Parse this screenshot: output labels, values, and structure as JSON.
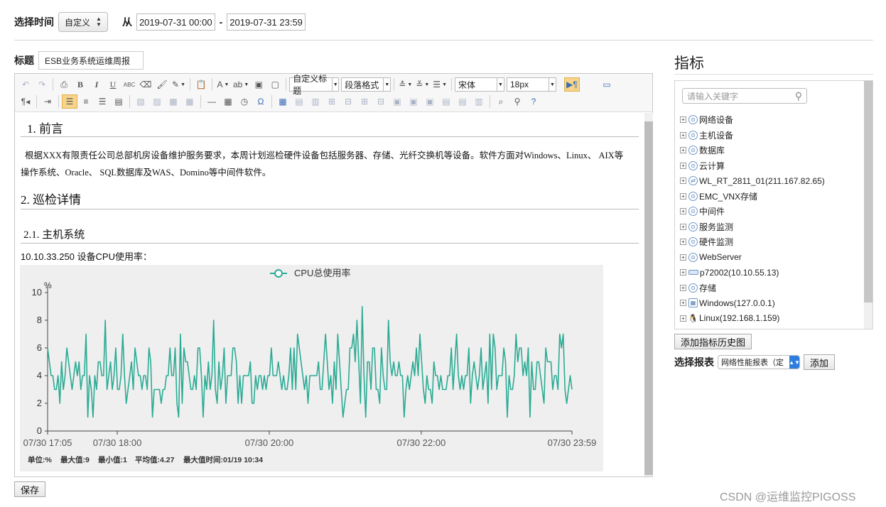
{
  "filter": {
    "time_label": "选择时间",
    "mode_value": "自定义",
    "from_label": "从",
    "start": "2019-07-31 00:00",
    "separator": "-",
    "end": "2019-07-31 23:59"
  },
  "title_row": {
    "label": "标题",
    "value": "ESB业务系统运维周报"
  },
  "toolbar": {
    "row1": [
      {
        "name": "undo-icon",
        "glyph": "↶",
        "dim": true
      },
      {
        "name": "redo-icon",
        "glyph": "↷",
        "dim": true
      },
      {
        "sep": true
      },
      {
        "name": "print-icon",
        "glyph": "⎙"
      },
      {
        "name": "bold-icon",
        "glyph": "B",
        "bold": true
      },
      {
        "name": "italic-icon",
        "glyph": "I",
        "italic": true
      },
      {
        "name": "underline-icon",
        "glyph": "U",
        "underline": true
      },
      {
        "name": "strikethrough-icon",
        "glyph": "ABC",
        "small": true
      },
      {
        "name": "eraser-icon",
        "glyph": "⌫"
      },
      {
        "name": "format-brush-icon",
        "glyph": "🖌"
      },
      {
        "name": "magic-format-icon",
        "glyph": "✎",
        "dd": true
      },
      {
        "sep": true
      },
      {
        "name": "paste-text-icon",
        "glyph": "📋"
      },
      {
        "sep": true
      },
      {
        "name": "font-color-icon",
        "glyph": "A",
        "dd": true
      },
      {
        "name": "background-color-icon",
        "glyph": "ab",
        "dd": true
      },
      {
        "name": "text-box-icon",
        "glyph": "▣"
      },
      {
        "name": "blank-page-icon",
        "glyph": "▢"
      },
      {
        "sep": true
      }
    ],
    "combo_custom_heading": "自定义标题",
    "combo_paragraph": "段落格式",
    "combo_font": "宋体",
    "combo_size": "18px",
    "row1_tail": [
      {
        "name": "row-spacing-top-icon",
        "glyph": "≛",
        "dd": true
      },
      {
        "name": "row-spacing-bottom-icon",
        "glyph": "≚",
        "dd": true
      },
      {
        "name": "line-height-icon",
        "glyph": "☰",
        "dd": true
      }
    ],
    "row2": [
      {
        "name": "paragraph-ltr-icon",
        "glyph": "¶◂"
      },
      {
        "sep": true
      },
      {
        "name": "indent-icon",
        "glyph": "⇥"
      },
      {
        "sep": true
      },
      {
        "name": "align-left-icon",
        "glyph": "☰",
        "active": true
      },
      {
        "name": "align-center-icon",
        "glyph": "≡"
      },
      {
        "name": "align-right-icon",
        "glyph": "☰"
      },
      {
        "name": "align-justify-icon",
        "glyph": "▤"
      },
      {
        "sep": true
      },
      {
        "name": "image-left-icon",
        "glyph": "▧",
        "dim": true
      },
      {
        "name": "image-right-icon",
        "glyph": "▨",
        "dim": true
      },
      {
        "name": "image-center-icon",
        "glyph": "▩",
        "dim": true
      },
      {
        "name": "image-none-icon",
        "glyph": "▦",
        "dim": true
      },
      {
        "sep": true
      },
      {
        "name": "horizontal-rule-icon",
        "glyph": "—"
      },
      {
        "name": "date-icon",
        "glyph": "▦"
      },
      {
        "name": "time-icon",
        "glyph": "◷"
      },
      {
        "name": "special-char-icon",
        "glyph": "Ω",
        "blue": true
      },
      {
        "sep": true
      },
      {
        "name": "insert-table-icon",
        "glyph": "▦",
        "blue": true
      },
      {
        "name": "delete-table-icon",
        "glyph": "▤",
        "dim": true
      },
      {
        "name": "insert-paragraph-before-table-icon",
        "glyph": "▥",
        "dim": true
      },
      {
        "name": "insert-row-icon",
        "glyph": "⊞",
        "dim": true
      },
      {
        "name": "delete-row-icon",
        "glyph": "⊟",
        "dim": true
      },
      {
        "name": "insert-col-icon",
        "glyph": "⊞",
        "dim": true
      },
      {
        "name": "delete-col-icon",
        "glyph": "⊟",
        "dim": true
      },
      {
        "name": "merge-cells-icon",
        "glyph": "▣",
        "dim": true
      },
      {
        "name": "merge-right-icon",
        "glyph": "▣",
        "dim": true
      },
      {
        "name": "merge-down-icon",
        "glyph": "▣",
        "dim": true
      },
      {
        "name": "split-cells-icon",
        "glyph": "▤",
        "dim": true
      },
      {
        "name": "split-rows-icon",
        "glyph": "▤",
        "dim": true
      },
      {
        "name": "split-cols-icon",
        "glyph": "▥",
        "dim": true
      },
      {
        "sep": true
      },
      {
        "name": "preview-icon",
        "glyph": "⌕"
      },
      {
        "name": "find-replace-icon",
        "glyph": "⚲"
      },
      {
        "name": "help-icon",
        "glyph": "?",
        "blue": true
      }
    ]
  },
  "doc": {
    "h1": "1. 前言",
    "para": "根据XXX有限责任公司总部机房设备维护服务要求，本周计划巡检硬件设备包括服务器、存储、光纤交换机等设备。软件方面对Windows、Linux、 AIX等操作系统、Oracle、 SQL数据库及WAS、Domino等中间件软件。",
    "h2": "2. 巡检详情",
    "h3": "2.1. 主机系统",
    "caption": "10.10.33.250 设备CPU使用率："
  },
  "chart_data": {
    "type": "line",
    "legend": "CPU总使用率",
    "series": [
      {
        "name": "CPU总使用率",
        "color": "#2bab94"
      }
    ],
    "y_unit": "%",
    "ylim": [
      0,
      10
    ],
    "y_ticks": [
      "0",
      "2",
      "4",
      "6",
      "8",
      "10"
    ],
    "x_ticks": [
      "07/30 17:05",
      "07/30 18:00",
      "07/30 20:00",
      "07/30 22:00",
      "07/30 23:59"
    ],
    "x_tick_minutes": [
      0,
      55,
      175,
      295,
      414
    ],
    "grid": false,
    "footer": {
      "unit": "单位:%",
      "max": "最大值:9",
      "min": "最小值:1",
      "avg": "平均值:4.27",
      "max_time": "最大值时间:01/19 10:34"
    }
  },
  "right": {
    "title": "指标",
    "search_placeholder": "请输入关键字",
    "tree": [
      {
        "label": "网络设备",
        "icon": "network-icon",
        "kind": "round"
      },
      {
        "label": "主机设备",
        "icon": "host-icon",
        "kind": "round"
      },
      {
        "label": "数据库",
        "icon": "database-icon",
        "kind": "round"
      },
      {
        "label": "云计算",
        "icon": "cloud-icon",
        "kind": "round"
      },
      {
        "label": "WL_RT_2811_01(211.167.82.65)",
        "icon": "router-icon",
        "kind": "router"
      },
      {
        "label": "EMC_VNX存储",
        "icon": "storage-icon",
        "kind": "round"
      },
      {
        "label": "中间件",
        "icon": "middleware-icon",
        "kind": "round"
      },
      {
        "label": "服务监测",
        "icon": "service-icon",
        "kind": "round"
      },
      {
        "label": "硬件监测",
        "icon": "hardware-icon",
        "kind": "round"
      },
      {
        "label": "WebServer",
        "icon": "webserver-icon",
        "kind": "round"
      },
      {
        "label": "p72002(10.10.55.13)",
        "icon": "server-bar-icon",
        "kind": "bar"
      },
      {
        "label": "存储",
        "icon": "storage-icon",
        "kind": "round"
      },
      {
        "label": "Windows(127.0.0.1)",
        "icon": "windows-icon",
        "kind": "win"
      },
      {
        "label": "Linux(192.168.1.159)",
        "icon": "linux-icon",
        "kind": "linux"
      }
    ],
    "history_button": "添加指标历史图",
    "report_label": "选择报表",
    "report_value": "网络性能报表（定",
    "add_button": "添加"
  },
  "save_button": "保存",
  "watermark": "CSDN @运维监控PIGOSS"
}
